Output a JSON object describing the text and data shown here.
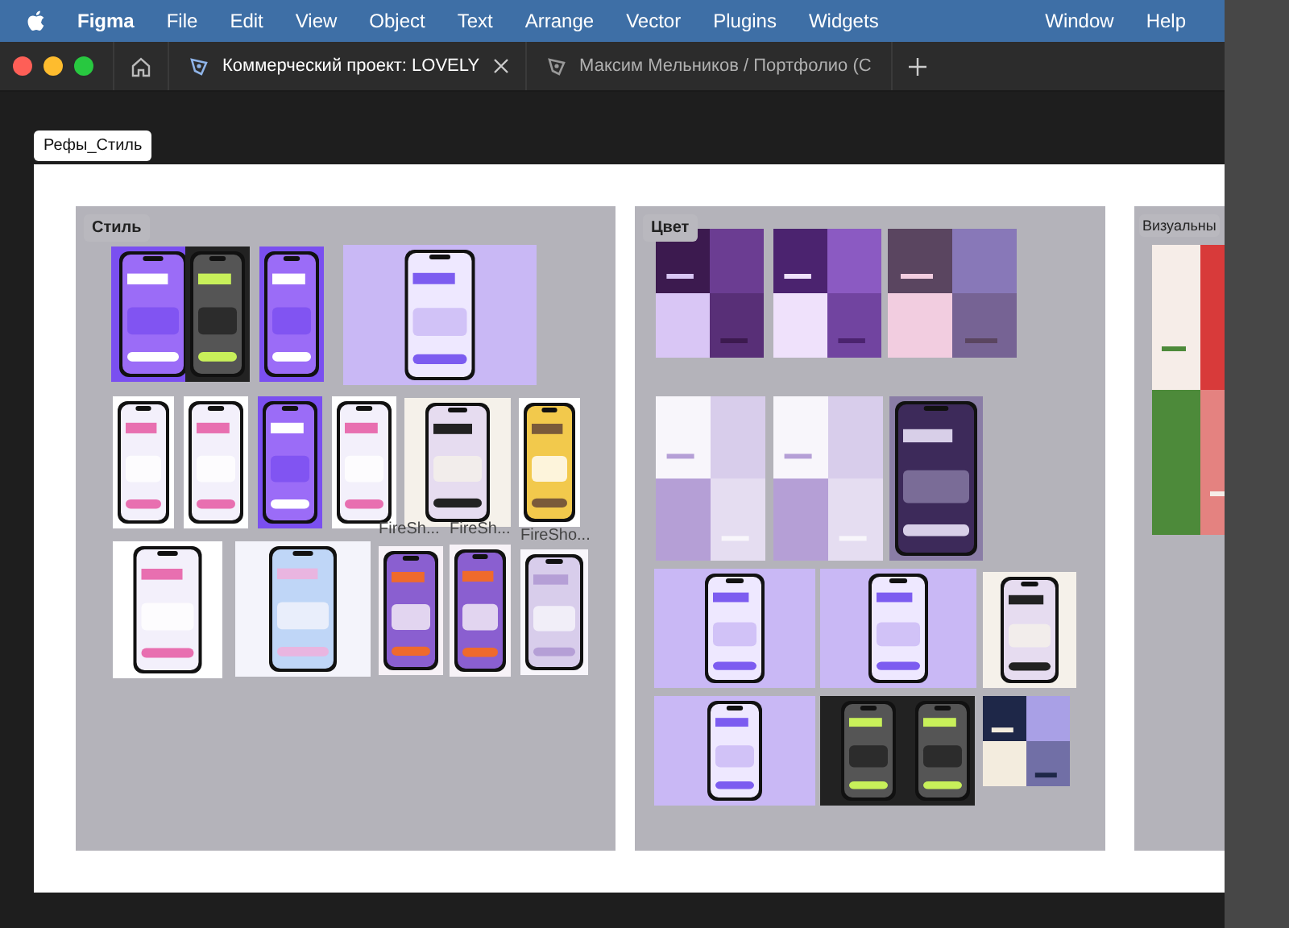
{
  "menu_bar": {
    "app": "Figma",
    "items": [
      "File",
      "Edit",
      "View",
      "Object",
      "Text",
      "Arrange",
      "Vector",
      "Plugins",
      "Widgets"
    ],
    "right_items": [
      "Window",
      "Help"
    ]
  },
  "tabs": [
    {
      "title": "Коммерческий проект: LOVELY",
      "selected": true
    },
    {
      "title": "Максим Мельников / Портфолио (С",
      "selected": false
    }
  ],
  "frame": {
    "title": "Рефы_Стиль",
    "sections": [
      {
        "title": "Стиль",
        "captions": [
          "FireSh...",
          "FireSh...",
          "FireSho..."
        ]
      },
      {
        "title": "Цвет"
      },
      {
        "title": "Визуальны"
      }
    ]
  }
}
